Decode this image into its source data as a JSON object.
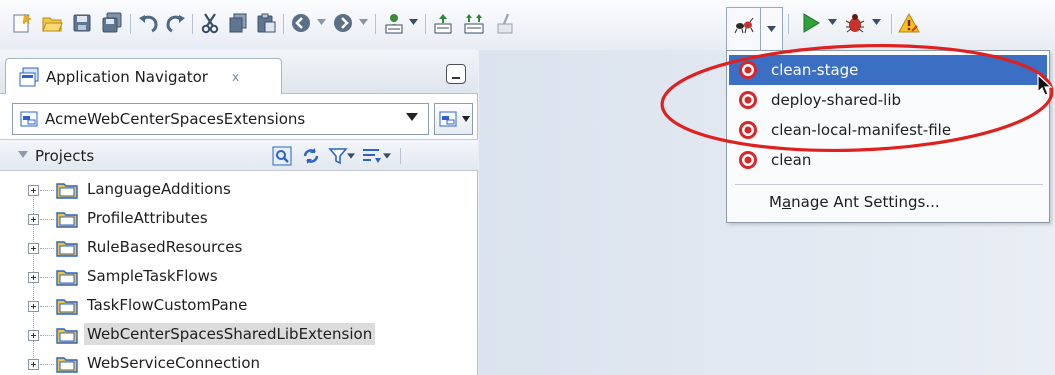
{
  "toolbar": {
    "icons": [
      "new-icon",
      "open-icon",
      "save-icon",
      "save-all-icon",
      "undo-icon",
      "redo-icon",
      "cut-icon",
      "copy-icon",
      "paste-icon",
      "back-icon",
      "forward-icon",
      "sql-worksheet-icon",
      "make-icon",
      "rebuild-icon",
      "clean-icon",
      "ant-icon",
      "run-icon",
      "debug-icon",
      "warning-icon"
    ]
  },
  "navigator": {
    "tab_label": "Application Navigator",
    "tab_close": "x",
    "application": "AcmeWebCenterSpacesExtensions",
    "projects_label": "Projects",
    "projects": [
      {
        "label": "LanguageAdditions",
        "selected": false
      },
      {
        "label": "ProfileAttributes",
        "selected": false
      },
      {
        "label": "RuleBasedResources",
        "selected": false
      },
      {
        "label": "SampleTaskFlows",
        "selected": false
      },
      {
        "label": "TaskFlowCustomPane",
        "selected": false
      },
      {
        "label": "WebCenterSpacesSharedLibExtension",
        "selected": true
      },
      {
        "label": "WebServiceConnection",
        "selected": false
      }
    ]
  },
  "ant_menu": {
    "targets": [
      {
        "label": "clean-stage",
        "selected": true
      },
      {
        "label": "deploy-shared-lib",
        "selected": false
      },
      {
        "label": "clean-local-manifest-file",
        "selected": false
      },
      {
        "label": "clean",
        "selected": false
      }
    ],
    "settings_prefix": "M",
    "settings_mnemonic": "a",
    "settings_rest": "nage Ant Settings..."
  },
  "colors": {
    "menu_selection": "#3a6fc4",
    "annotation_ellipse": "#e0201f",
    "target_icon": "#d8262a",
    "folder": "#2a64c8"
  }
}
